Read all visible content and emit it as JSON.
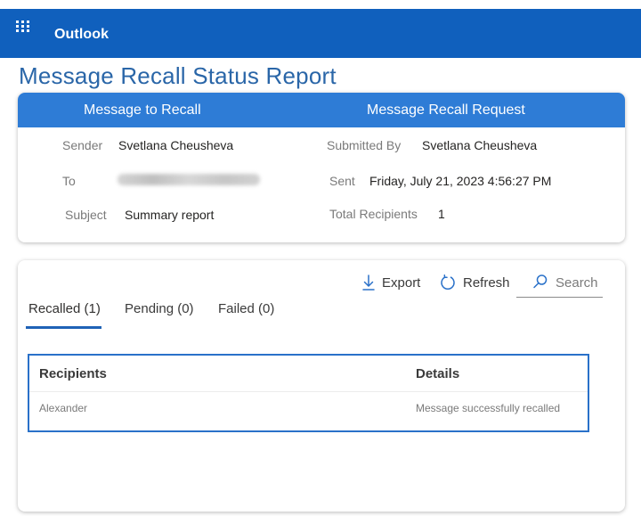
{
  "app": {
    "name": "Outlook"
  },
  "page": {
    "title": "Message Recall Status Report"
  },
  "message_card": {
    "left_header": "Message to Recall",
    "right_header": "Message Recall Request",
    "sender": {
      "label": "Sender",
      "value": "Svetlana Cheusheva"
    },
    "to": {
      "label": "To"
    },
    "subject": {
      "label": "Subject",
      "value": "Summary report"
    },
    "submitted_by": {
      "label": "Submitted By",
      "value": "Svetlana Cheusheva"
    },
    "sent": {
      "label": "Sent",
      "value": "Friday, July 21, 2023 4:56:27  PM"
    },
    "total_recipients": {
      "label": "Total Recipients",
      "value": "1"
    }
  },
  "toolbar": {
    "export_label": "Export",
    "refresh_label": "Refresh",
    "search_placeholder": "Search"
  },
  "tabs": [
    {
      "label": "Recalled (1)",
      "active": true
    },
    {
      "label": "Pending (0)",
      "active": false
    },
    {
      "label": "Failed (0)",
      "active": false
    }
  ],
  "table": {
    "columns": [
      "Recipients",
      "Details"
    ],
    "rows": [
      [
        "Alexander",
        "Message successfully recalled"
      ]
    ]
  },
  "colors": {
    "topbar": "#1060bd",
    "card_header": "#2e7cd6",
    "title": "#2a66a8",
    "accent": "#1f62b6"
  },
  "icons": [
    "app-launcher-icon",
    "download-icon",
    "refresh-icon",
    "search-icon"
  ]
}
